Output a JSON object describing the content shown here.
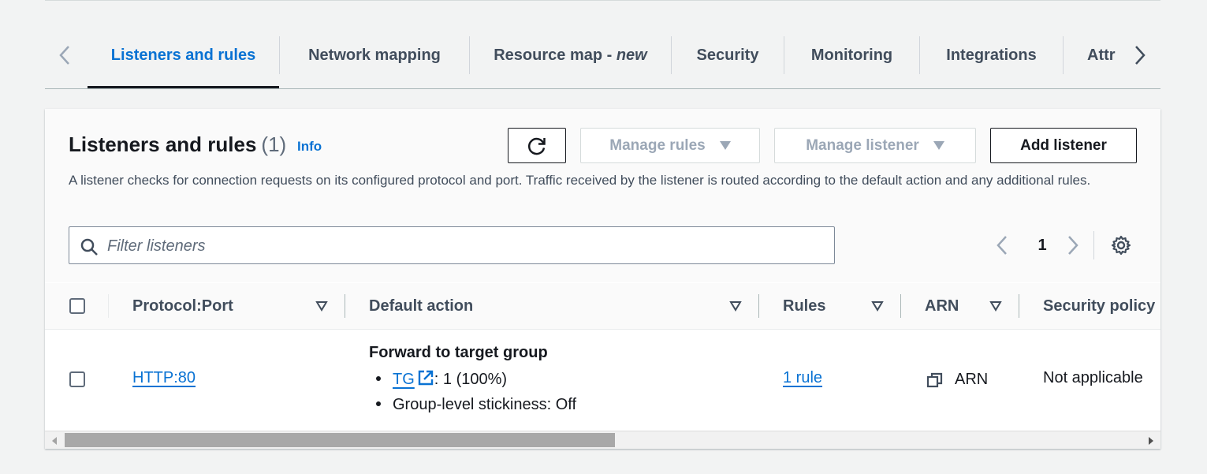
{
  "tabs": {
    "items": [
      {
        "label": "Listeners and rules"
      },
      {
        "label": "Network mapping"
      },
      {
        "label": "Resource map - ",
        "suffix": "new"
      },
      {
        "label": "Security"
      },
      {
        "label": "Monitoring"
      },
      {
        "label": "Integrations"
      },
      {
        "label": "Attr"
      }
    ],
    "active_index": 0
  },
  "panel": {
    "title": "Listeners and rules",
    "count": "(1)",
    "info": "Info",
    "description": "A listener checks for connection requests on its configured protocol and port. Traffic received by the listener is routed according to the default action and any additional rules.",
    "buttons": {
      "manage_rules": "Manage rules",
      "manage_listener": "Manage listener",
      "add_listener": "Add listener"
    },
    "search_placeholder": "Filter listeners",
    "pagination": {
      "current_page": "1"
    }
  },
  "table": {
    "columns": [
      "Protocol:Port",
      "Default action",
      "Rules",
      "ARN",
      "Security policy"
    ],
    "rows": [
      {
        "protocol_port": "HTTP:80",
        "default_action": {
          "title": "Forward to target group",
          "target_group": "TG",
          "target_weight": ": 1 (100%)",
          "stickiness": "Group-level stickiness: Off"
        },
        "rules": "1 rule",
        "arn": "ARN",
        "security_policy": "Not applicable"
      }
    ]
  },
  "colors": {
    "accent": "#0972d3",
    "text": "#16191f",
    "muted": "#414d5c",
    "disabled": "#9ba7b6",
    "background": "#f2f3f3"
  }
}
